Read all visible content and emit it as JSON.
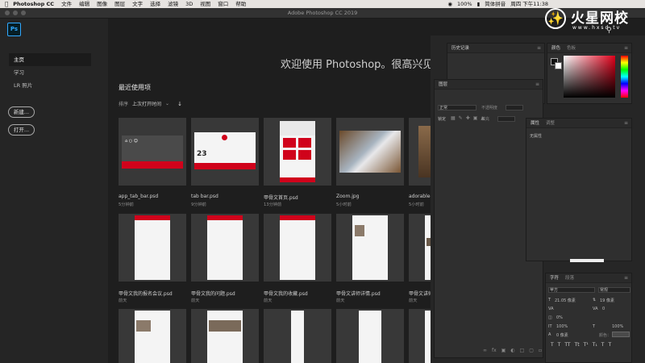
{
  "menubar": {
    "app": "Photoshop CC",
    "items": [
      "文件",
      "编辑",
      "图像",
      "图层",
      "文字",
      "选择",
      "滤镜",
      "3D",
      "视图",
      "窗口",
      "帮助"
    ],
    "battery": "100%",
    "ime": "简体拼音",
    "clock": "周四 下午11:38"
  },
  "window": {
    "title": "Adobe Photoshop CC 2019"
  },
  "watermark": {
    "brand": "火星网校",
    "url": "www.hxsd.tv"
  },
  "sidebar": {
    "logo": "Ps",
    "items": [
      {
        "label": "主页"
      },
      {
        "label": "学习"
      },
      {
        "label": "LR 照片"
      }
    ],
    "new_label": "新建...",
    "open_label": "打开..."
  },
  "home": {
    "welcome": "欢迎使用 Photoshop。很高兴见到你",
    "recent_title": "最近使用项",
    "sort_label": "排序",
    "sort_value": "上次打开时间",
    "files": [
      {
        "name": "app_tab_bar.psd",
        "time": "5分钟前"
      },
      {
        "name": "tab bar.psd",
        "time": "9分钟前"
      },
      {
        "name": "甲骨文首页.psd",
        "time": "13分钟前"
      },
      {
        "name": "Zoom.jpg",
        "time": "5小时前"
      },
      {
        "name": "adorable-ar",
        "time": "5小时前"
      },
      {
        "name": "甲骨文我的报名会议.psd",
        "time": "前天"
      },
      {
        "name": "甲骨文我的问题.psd",
        "time": "前天"
      },
      {
        "name": "甲骨文我的收藏.psd",
        "time": "前天"
      },
      {
        "name": "甲骨文讲师详情.psd",
        "time": "前天"
      },
      {
        "name": "甲骨文讲师",
        "time": "前天"
      }
    ],
    "thumb_date": "23"
  },
  "panels": {
    "history": {
      "title": "历史记录"
    },
    "color": {
      "tab1": "颜色",
      "tab2": "色板"
    },
    "layers": {
      "title": "图层",
      "kind": "正常",
      "opacity_label": "不透明度",
      "lock_label": "锁定",
      "fill_label": "填充"
    },
    "properties": {
      "tab1": "属性",
      "tab2": "调整",
      "empty": "无属性"
    },
    "character": {
      "tab1": "字符",
      "tab2": "段落",
      "font": "苹方",
      "style": "常规",
      "size": "21.05 像素",
      "leading": "19 像素",
      "kerning": "0",
      "tracking_pct": "0%",
      "scale_v": "100%",
      "scale_h": "100%",
      "baseline": "0 像素",
      "color_label": "颜色："
    }
  },
  "colors": {
    "accent_red": "#d0021b",
    "ps_blue": "#31a8ff"
  }
}
